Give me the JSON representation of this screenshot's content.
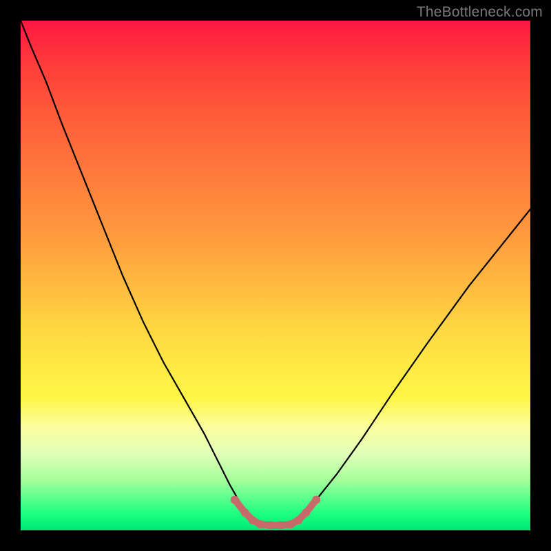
{
  "watermark": {
    "text": "TheBottleneck.com"
  },
  "colors": {
    "curve": "#000000",
    "marker": "#c96a6a",
    "plot_border": "#000000"
  },
  "chart_data": {
    "type": "line",
    "title": "",
    "xlabel": "",
    "ylabel": "",
    "xlim": [
      0,
      100
    ],
    "ylim": [
      0,
      100
    ],
    "series": [
      {
        "name": "bottleneck-curve",
        "x": [
          0,
          2,
          5,
          8,
          12,
          16,
          20,
          24,
          28,
          32,
          36,
          39,
          41,
          43,
          45,
          47,
          49,
          51,
          53,
          55,
          58,
          62,
          67,
          73,
          80,
          88,
          96,
          100
        ],
        "y": [
          100,
          95,
          88,
          80,
          70,
          60,
          50,
          41,
          33,
          26,
          19,
          13,
          9,
          5.5,
          3,
          1.5,
          1,
          1,
          1.5,
          3,
          6,
          11,
          18,
          27,
          37,
          48,
          58,
          63
        ]
      }
    ],
    "markers": {
      "name": "bottom-valley-markers",
      "points": [
        {
          "x": 42,
          "y": 6
        },
        {
          "x": 44,
          "y": 3.5
        },
        {
          "x": 45.5,
          "y": 2
        },
        {
          "x": 47,
          "y": 1.2
        },
        {
          "x": 49,
          "y": 1
        },
        {
          "x": 51,
          "y": 1
        },
        {
          "x": 53,
          "y": 1.2
        },
        {
          "x": 54.5,
          "y": 2
        },
        {
          "x": 56,
          "y": 3.5
        },
        {
          "x": 58,
          "y": 6
        }
      ]
    }
  }
}
